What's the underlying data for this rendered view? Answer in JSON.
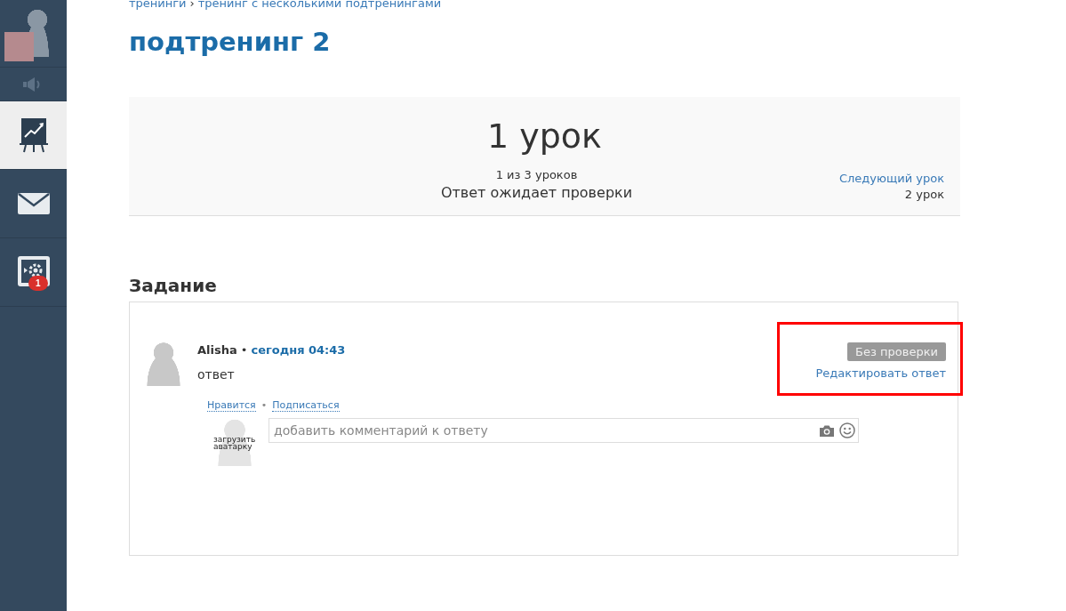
{
  "sidebar": {
    "items": [
      {
        "kind": "sound",
        "selected": false
      },
      {
        "kind": "trainings",
        "selected": true
      },
      {
        "kind": "messages",
        "selected": false
      },
      {
        "kind": "admin",
        "selected": false,
        "badge": "1"
      }
    ]
  },
  "breadcrumbs": [
    {
      "label": "тренинги"
    },
    {
      "label": "тренинг с несколькими подтренингами"
    }
  ],
  "breadcrumb_separator": "›",
  "page_title": "подтренинг 2",
  "lesson": {
    "title": "1 урок",
    "progress": "1 из 3 уроков",
    "status": "Ответ ожидает проверки",
    "next_link": "Следующий урок",
    "next_title": "2 урок"
  },
  "task": {
    "heading": "Задание",
    "answer": {
      "author": "Alisha",
      "separator": "•",
      "time": "сегодня 04:43",
      "text": "ответ",
      "status_badge": "Без проверки",
      "edit_link": "Редактировать ответ",
      "highlighted": true,
      "actions": [
        "Нравится",
        "Подписаться"
      ],
      "action_separator": "•"
    },
    "comment": {
      "avatar_label": "загрузить аватарку",
      "placeholder": "добавить комментарий к ответу"
    }
  }
}
